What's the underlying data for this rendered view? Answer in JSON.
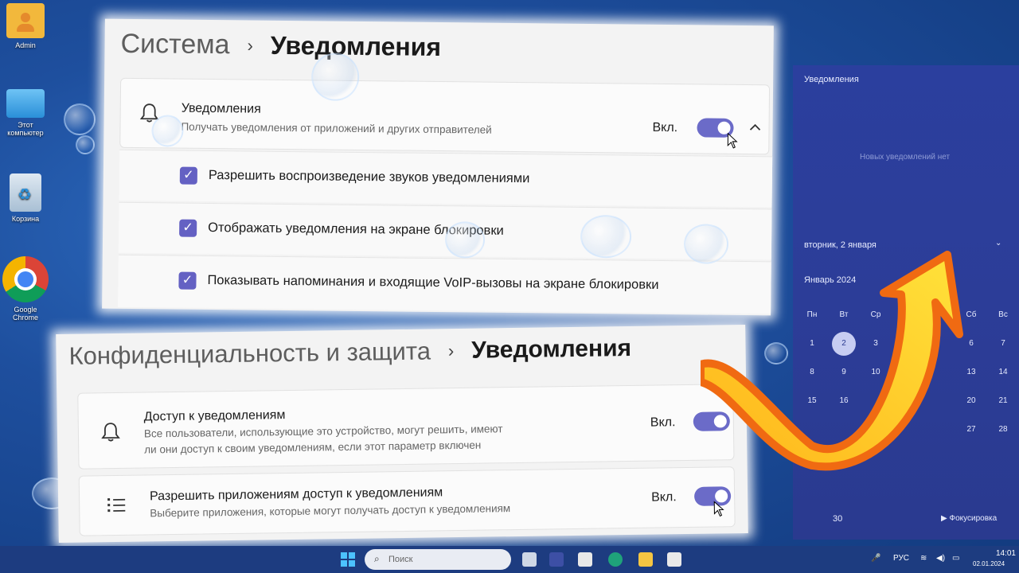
{
  "desktop": {
    "icons": [
      {
        "label": "Admin"
      },
      {
        "label": "Этот компьютер"
      },
      {
        "label": "Корзина"
      },
      {
        "label": "Google Chrome"
      }
    ]
  },
  "system_panel": {
    "breadcrumb_parent": "Система",
    "breadcrumb_separator": "›",
    "breadcrumb_current": "Уведомления",
    "notifications_title": "Уведомления",
    "notifications_subtitle": "Получать уведомления от приложений и других отправителей",
    "toggle_label": "Вкл.",
    "checkboxes": [
      {
        "label": "Разрешить воспроизведение звуков уведомлениями"
      },
      {
        "label": "Отображать уведомления на экране блокировки"
      },
      {
        "label": "Показывать напоминания и входящие VoIP-вызовы на экране блокировки"
      }
    ]
  },
  "privacy_panel": {
    "breadcrumb_parent": "Конфиденциальность и защита",
    "breadcrumb_separator": "›",
    "breadcrumb_current": "Уведомления",
    "access_title": "Доступ к уведомлениям",
    "access_subtitle_line1": "Все пользователи, использующие это устройство, могут решить, имеют",
    "access_subtitle_line2": "ли они доступ к своим уведомлениям, если этот параметр включен",
    "access_toggle_label": "Вкл.",
    "apps_title": "Разрешить приложениям доступ к уведомлениям",
    "apps_subtitle": "Выберите приложения, которые могут получать доступ к уведомлениям",
    "apps_toggle_label": "Вкл."
  },
  "flyout": {
    "title": "Уведомления",
    "empty_text": "Новых уведомлений нет",
    "date_label": "вторник, 2 января",
    "month_label": "Январь 2024",
    "weekdays": [
      "Пн",
      "Вт",
      "Ср",
      "",
      "",
      "Сб",
      "Вс"
    ],
    "weeks": [
      [
        "1",
        "2",
        "3",
        "",
        "",
        "6",
        "7"
      ],
      [
        "8",
        "9",
        "10",
        "",
        "",
        "13",
        "14"
      ],
      [
        "15",
        "16",
        "",
        "",
        "",
        "20",
        "21"
      ],
      [
        "",
        "",
        "",
        "",
        "",
        "27",
        "28"
      ]
    ],
    "focus_minutes": "30",
    "focus_label": "Фокусировка"
  },
  "taskbar": {
    "search_placeholder": "Поиск",
    "language": "РУС",
    "time": "14:01",
    "date": "02.01.2024"
  },
  "colors": {
    "accent": "#6b6bc8",
    "arrow_orange": "#f47a1f",
    "arrow_yellow": "#ffd21a"
  }
}
